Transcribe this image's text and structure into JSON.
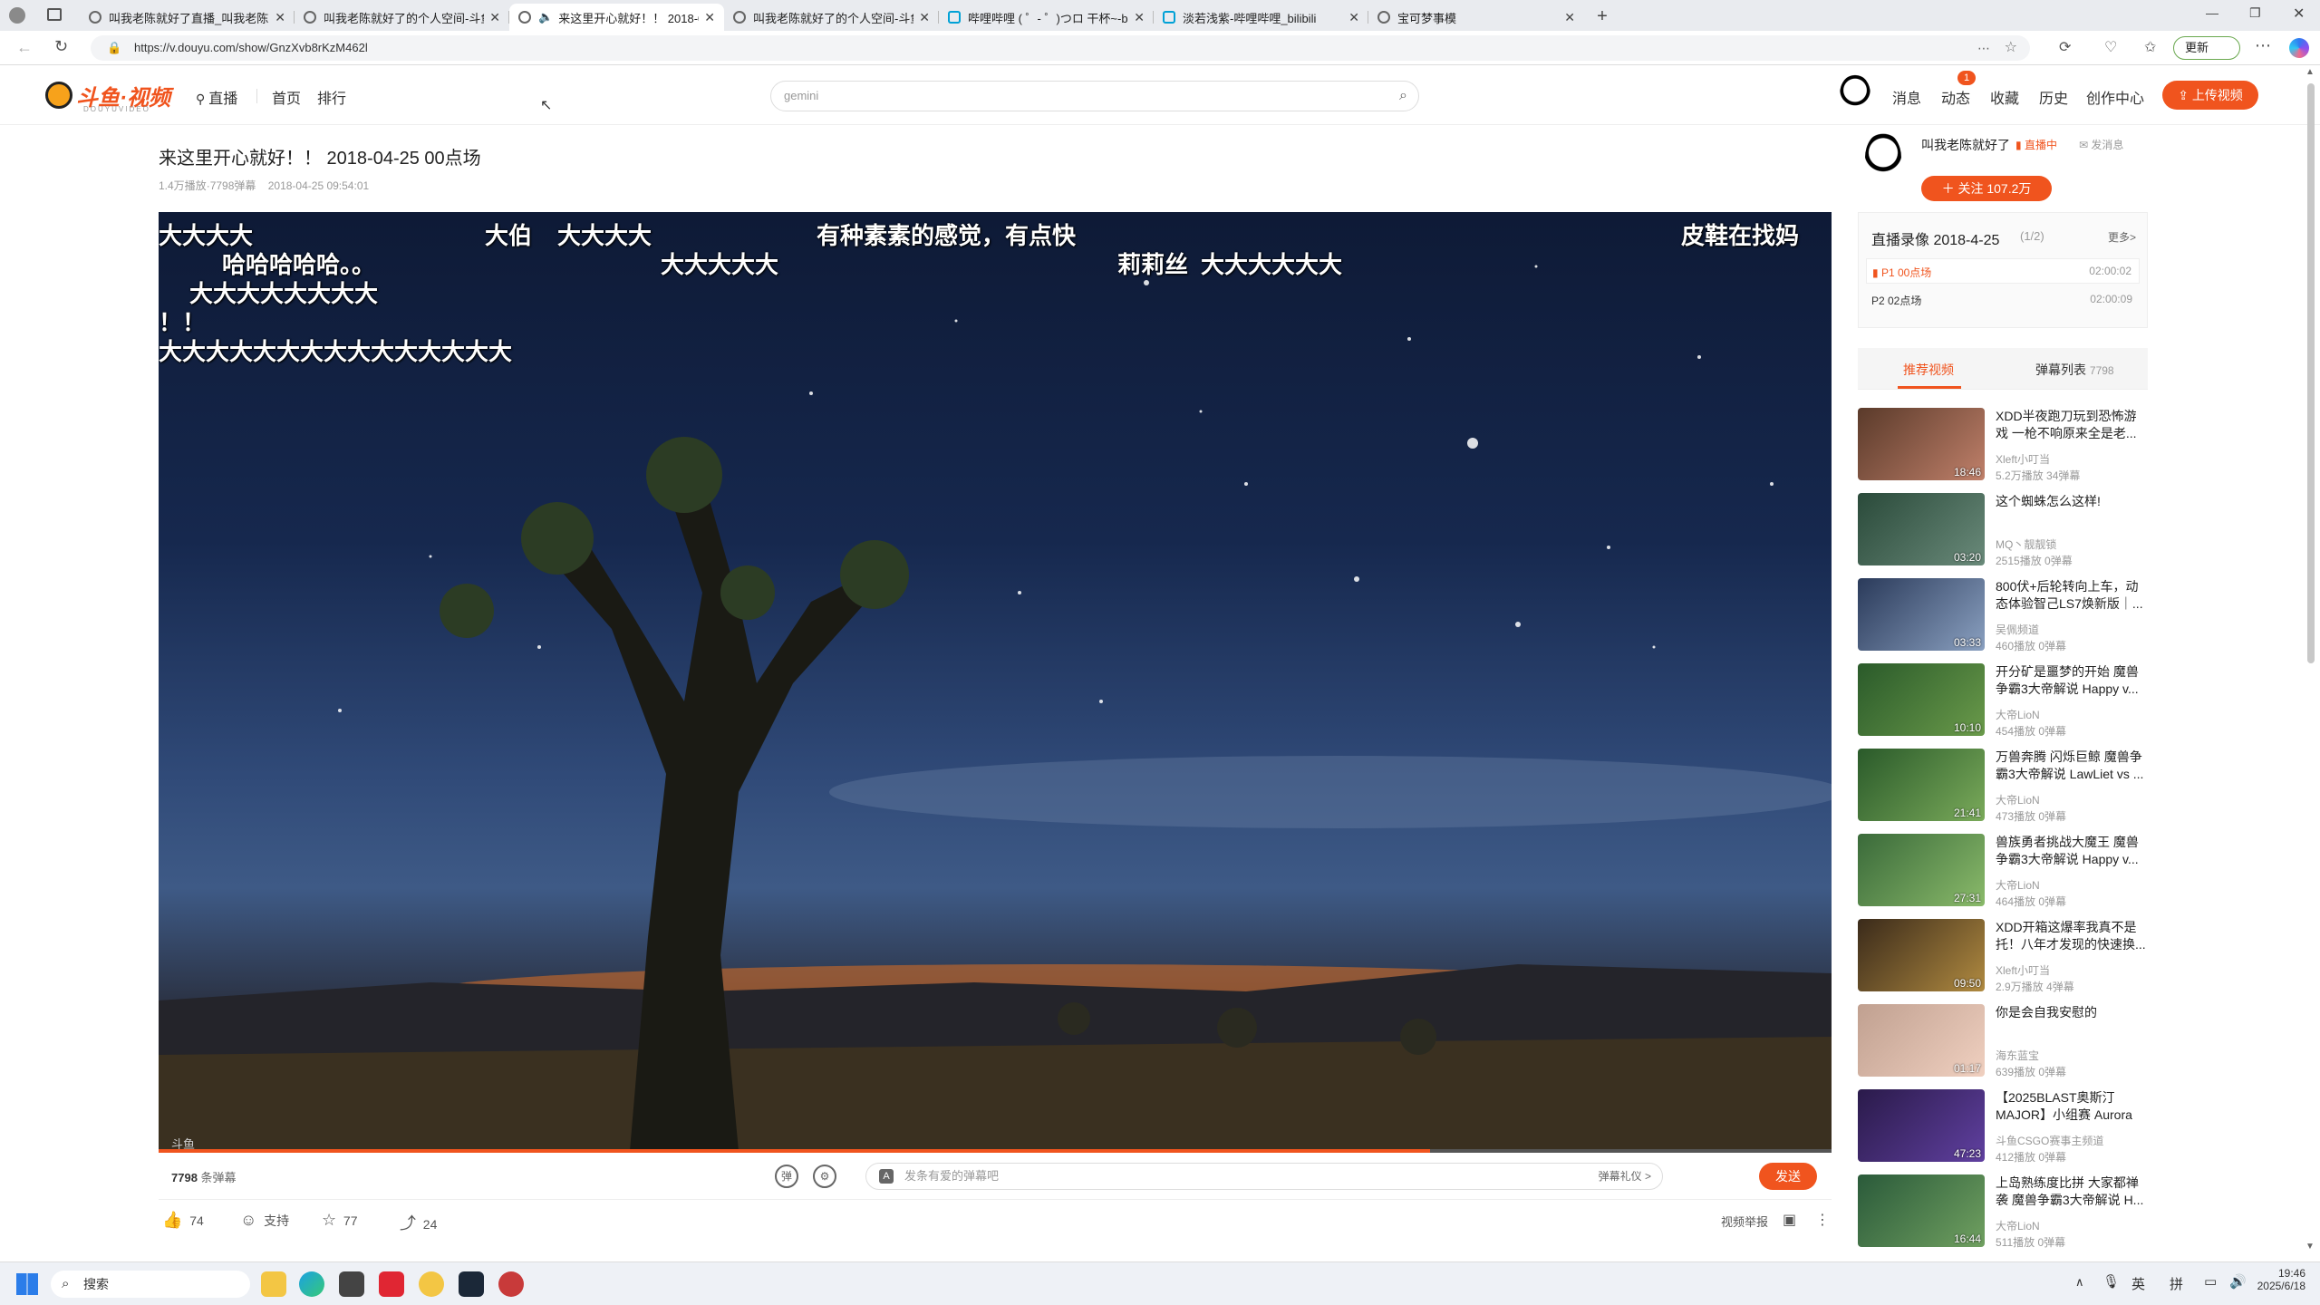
{
  "browser": {
    "tabs": [
      {
        "title": "叫我老陈就好了直播_叫我老陈就好"
      },
      {
        "title": "叫我老陈就好了的个人空间-斗鱼"
      },
      {
        "title": "来这里开心就好！！ 2018-0"
      },
      {
        "title": "叫我老陈就好了的个人空间-斗鱼"
      },
      {
        "title": "哔哩哔哩 ( ゜- ゜)つロ 干杯~-bili"
      },
      {
        "title": "淡若浅紫-哔哩哔哩_bilibili"
      },
      {
        "title": "宝可梦事模"
      }
    ],
    "url": "https://v.douyu.com/show/GnzXvb8rKzM462l",
    "update_label": "更新"
  },
  "header": {
    "logo_text": "斗鱼·视频",
    "logo_sub": "DOUYUVIDEO",
    "nav": [
      "直播",
      "首页",
      "排行"
    ],
    "search_placeholder": "gemini",
    "links": [
      "消息",
      "动态",
      "收藏",
      "历史",
      "创作中心"
    ],
    "notif_count": "1",
    "upload_label": "上传视频"
  },
  "video": {
    "title": "来这里开心就好！！ 2018-04-25 00点场",
    "views": "1.4万播放",
    "danmaku_count_meta": "7798弹幕",
    "date": "2018-04-25 09:54:01",
    "watermark": "斗鱼",
    "progress": 0.76,
    "danmaku": [
      "大大大大",
      "大伯",
      "大大大大",
      "有种素素的感觉，有点快",
      "皮鞋在找妈",
      "哈哈哈哈哈。。",
      "大大大大大",
      "莉莉丝",
      "大大大大大大",
      "大大大大大大大大",
      "！！",
      "大大大大大大大大大大大大大大大"
    ]
  },
  "controls": {
    "count": "7798",
    "count_suffix": "条弹幕",
    "input_placeholder": "发条有爱的弹幕吧",
    "etiquette": "弹幕礼仪 >",
    "send": "发送"
  },
  "actions": {
    "like": "74",
    "support": "支持",
    "fav": "77",
    "share": "24",
    "report": "视频举报"
  },
  "author": {
    "name": "叫我老陈就好了",
    "live_status": "直播中",
    "message": "发消息",
    "follow_label": "关注",
    "followers": "107.2万"
  },
  "recording": {
    "title": "直播录像 2018-4-25",
    "pages": "(1/2)",
    "more": "更多>",
    "parts": [
      {
        "name": "P1 00点场",
        "duration": "02:00:02"
      },
      {
        "name": "P2 02点场",
        "duration": "02:00:09"
      }
    ]
  },
  "sidetabs": {
    "recommend": "推荐视频",
    "danmaku_list": "弹幕列表",
    "danmaku_count": "7798"
  },
  "recommendations": [
    {
      "title": "XDD半夜跑刀玩到恐怖游戏 一枪不响原来全是老...",
      "author": "Xleft小叮当",
      "stats": "5.2万播放   34弹幕",
      "duration": "18:46"
    },
    {
      "title": "这个蜘蛛怎么这样!",
      "author": "MQ丶靓靓锁",
      "stats": "2515播放   0弹幕",
      "duration": "03:20"
    },
    {
      "title": "800伏+后轮转向上车，动态体验智己LS7焕新版｜...",
      "author": "吴佩频道",
      "stats": "460播放   0弹幕",
      "duration": "03:33"
    },
    {
      "title": "开分矿是噩梦的开始 魔兽争霸3大帝解说 Happy v...",
      "author": "大帝LioN",
      "stats": "454播放   0弹幕",
      "duration": "10:10"
    },
    {
      "title": "万兽奔腾 闪烁巨鲸 魔兽争霸3大帝解说 LawLiet vs ...",
      "author": "大帝LioN",
      "stats": "473播放   0弹幕",
      "duration": "21:41"
    },
    {
      "title": "兽族勇者挑战大魔王 魔兽争霸3大帝解说 Happy v...",
      "author": "大帝LioN",
      "stats": "464播放   0弹幕",
      "duration": "27:31"
    },
    {
      "title": "XDD开箱这爆率我真不是托！八年才发现的快速换...",
      "author": "Xleft小叮当",
      "stats": "2.9万播放   4弹幕",
      "duration": "09:50"
    },
    {
      "title": "你是会自我安慰的",
      "author": "海东蓝宝",
      "stats": "639播放   0弹幕",
      "duration": "01:17"
    },
    {
      "title": "【2025BLAST奥斯汀MAJOR】小组赛 Aurora vs ...",
      "author": "斗鱼CSGO赛事主频道",
      "stats": "412播放   0弹幕",
      "duration": "47:23"
    },
    {
      "title": "上岛熟练度比拼 大家都禅袭 魔兽争霸3大帝解说 H...",
      "author": "大帝LioN",
      "stats": "511播放   0弹幕",
      "duration": "16:44"
    }
  ],
  "taskbar": {
    "search": "搜索",
    "ime1": "英",
    "ime2": "拼",
    "time": "19:46",
    "date": "2025/6/18"
  }
}
